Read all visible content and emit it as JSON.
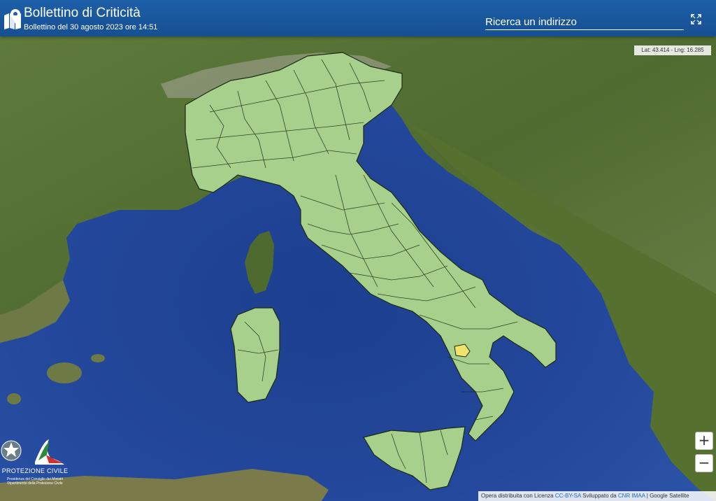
{
  "header": {
    "title": "Bollettino di Criticità",
    "subtitle": "Bollettino del 30 agosto 2023 ore 14:51",
    "search_placeholder": "Ricerca un indirizzo"
  },
  "map": {
    "coords_readout": "Lat: 43.414 - Lng: 16.285",
    "zoom_in_label": "+",
    "zoom_out_label": "−",
    "alert_colors": {
      "green": "#a8d08d",
      "yellow": "#f2e46a"
    },
    "sea_color": "#22489a",
    "land_color": "#5d7a3a"
  },
  "attribution": {
    "prefix": "Opera distribuita con Licenza",
    "license": "CC-BY-SA",
    "middle": "Sviluppato da",
    "developer": "CNR IMAA",
    "suffix": "| Google Satellite"
  },
  "brand": {
    "name": "PROTEZIONE CIVILE",
    "line1": "Presidenza del Consiglio dei Ministri",
    "line2": "Dipartimento della Protezione Civile"
  }
}
